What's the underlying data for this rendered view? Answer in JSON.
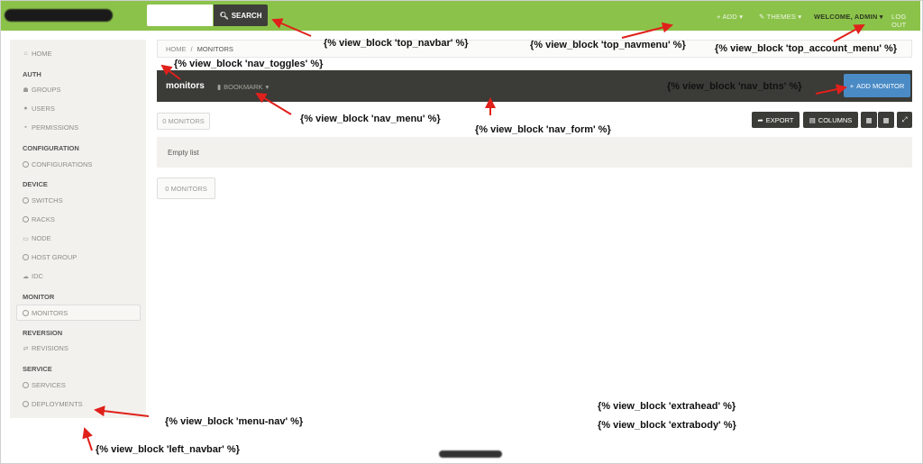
{
  "topbar": {
    "search_placeholder": "",
    "search_label": "SEARCH",
    "add_label": "ADD",
    "themes_label": "THEMES",
    "welcome_label": "WELCOME, ADMIN",
    "logout_label": "LOG OUT"
  },
  "sidebar": {
    "home": "HOME",
    "auth": "AUTH",
    "groups": "GROUPS",
    "users": "USERS",
    "permissions": "PERMISSIONS",
    "configuration": "CONFIGURATION",
    "configurations": "CONFIGURATIONS",
    "device": "DEVICE",
    "switchs": "SWITCHS",
    "racks": "RACKS",
    "node": "NODE",
    "host_group": "HOST GROUP",
    "idc": "IDC",
    "monitor": "MONITOR",
    "monitors": "MONITORS",
    "reversion": "REVERSION",
    "revisions": "REVISIONS",
    "service": "SERVICE",
    "services": "SERVICES",
    "deployments": "DEPLOYMENTS"
  },
  "breadcrumb": {
    "home": "HOME",
    "current": "MONITORS"
  },
  "nav": {
    "title": "monitors",
    "bookmark": "BOOKMARK",
    "add_monitor": "ADD MONITOR"
  },
  "toolbar": {
    "count": "0 MONITORS",
    "export": "EXPORT",
    "columns": "COLUMNS"
  },
  "list": {
    "empty": "Empty list",
    "count_bottom": "0 MONITORS"
  },
  "annotations": {
    "top_navbar": "{% view_block 'top_navbar' %}",
    "top_navmenu": "{% view_block 'top_navmenu' %}",
    "top_account_menu": "{% view_block 'top_account_menu' %}",
    "nav_toggles": "{% view_block 'nav_toggles' %}",
    "nav_btns": "{% view_block 'nav_btns' %}",
    "nav_menu": "{% view_block 'nav_menu' %}",
    "nav_form": "{% view_block 'nav_form' %}",
    "extrahead": "{% view_block 'extrahead' %}",
    "extrabody": "{% view_block 'extrabody' %}",
    "menu_nav": "{% view_block 'menu-nav' %}",
    "left_navbar": "{% view_block 'left_navbar' %}"
  },
  "colors": {
    "topbar": "#8bc34a",
    "navband": "#3b3b37",
    "accent": "#4a8bc6",
    "arrow": "#e0201b"
  }
}
